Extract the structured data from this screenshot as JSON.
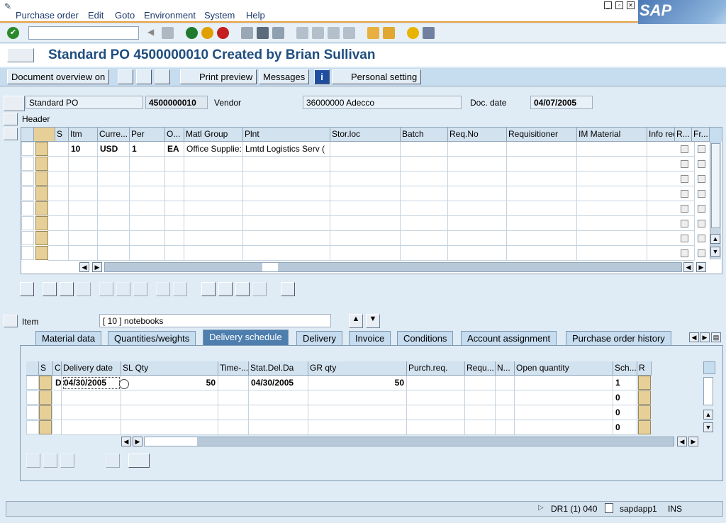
{
  "menu": [
    "Purchase order",
    "Edit",
    "Goto",
    "Environment",
    "System",
    "Help"
  ],
  "sap_logo": "SAP",
  "command_field": "",
  "title": "Standard PO 4500000010 Created by Brian Sullivan",
  "app_toolbar": {
    "document_overview": "Document overview on",
    "print_preview": "Print preview",
    "messages": "Messages",
    "personal_setting": "Personal setting"
  },
  "header_fields": {
    "doc_type": "Standard PO",
    "po_number": "4500000010",
    "vendor_label": "Vendor",
    "vendor_value": "36000000 Adecco",
    "doc_date_label": "Doc. date",
    "doc_date_value": "04/07/2005"
  },
  "header_label": "Header",
  "item_grid": {
    "columns": [
      "S",
      "Itm",
      "Curre...",
      "Per",
      "O...",
      "Matl Group",
      "Plnt",
      "Stor.loc",
      "Batch",
      "Req.No",
      "Requisitioner",
      "IM Material",
      "Info rec.",
      "R...",
      "Fr..."
    ],
    "rows": [
      {
        "itm": "10",
        "curr": "USD",
        "per": "1",
        "o": "EA",
        "matl_group": "Office Supplie:",
        "plnt": "Lmtd Logistics Serv ("
      }
    ]
  },
  "item_selector": {
    "label": "Item",
    "value": "[ 10 ] notebooks"
  },
  "tabs": [
    "Material data",
    "Quantities/weights",
    "Delivery schedule",
    "Delivery",
    "Invoice",
    "Conditions",
    "Account assignment",
    "Purchase order history"
  ],
  "active_tab": "Delivery schedule",
  "schedule_grid": {
    "columns": [
      "S",
      "C",
      "Delivery date",
      "SL Qty",
      "Time-...",
      "Stat.Del.Da",
      "GR qty",
      "Purch.req.",
      "Requ...",
      "N...",
      "Open quantity",
      "Sch...",
      "R"
    ],
    "rows": [
      {
        "c": "D",
        "delivery_date": "04/30/2005",
        "sl_qty": "50",
        "stat_del": "04/30/2005",
        "gr_qty": "50",
        "sch": "1"
      },
      {
        "sch": "0"
      },
      {
        "sch": "0"
      },
      {
        "sch": "0"
      }
    ]
  },
  "status": {
    "system": "DR1 (1) 040",
    "server": "sapdapp1",
    "mode": "INS"
  }
}
